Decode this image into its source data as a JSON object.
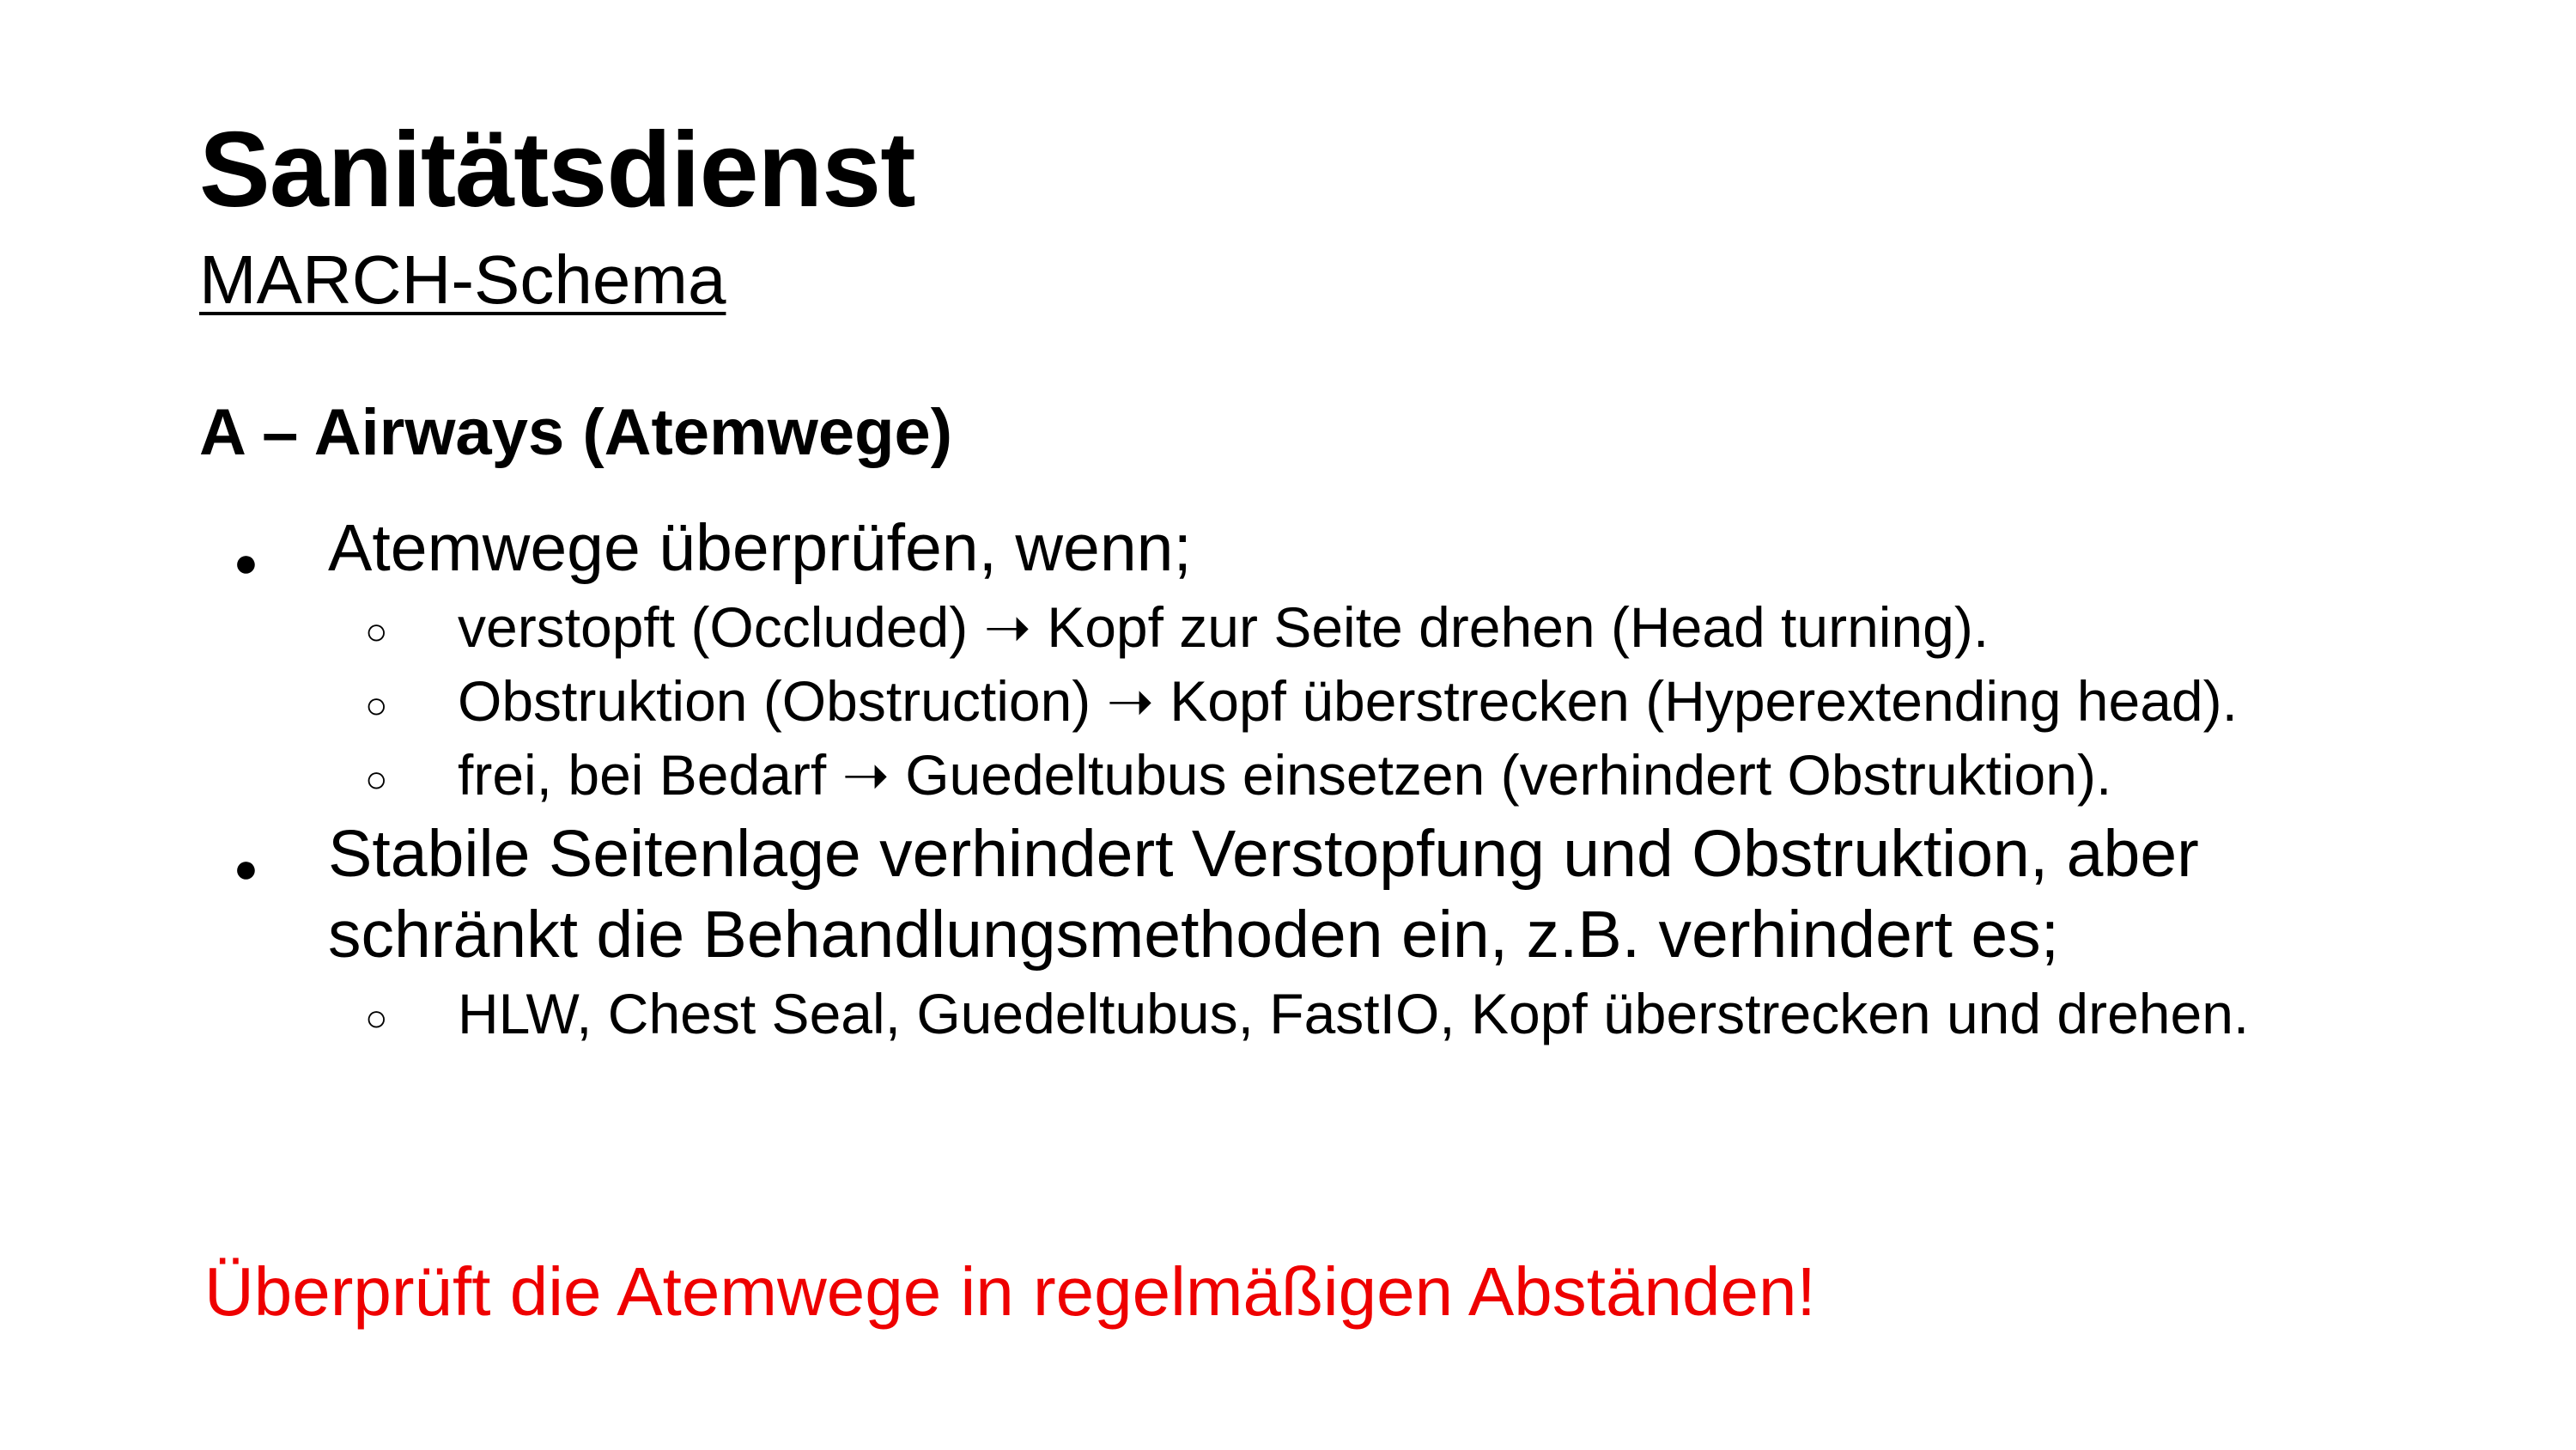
{
  "slide": {
    "title": "Sanitätsdienst",
    "subtitle": "MARCH-Schema",
    "section_heading": "A – Airways (Atemwege)",
    "bullets": [
      {
        "marker": "●",
        "lines": [
          "Atemwege überprüfen, wenn;"
        ],
        "sub": [
          {
            "marker": "○",
            "text": "verstopft (Occluded) ➝ Kopf zur Seite drehen (Head turning)."
          },
          {
            "marker": "○",
            "text": "Obstruktion (Obstruction) ➝ Kopf überstrecken (Hyperextending head)."
          },
          {
            "marker": "○",
            "text": "frei, bei Bedarf ➝ Guedeltubus einsetzen (verhindert Obstruktion)."
          }
        ]
      },
      {
        "marker": "●",
        "lines": [
          "Stabile Seitenlage verhindert Verstopfung und Obstruktion, aber",
          "schränkt die Behandlungsmethoden ein, z.B. verhindert es;"
        ],
        "sub": [
          {
            "marker": "○",
            "text": "HLW, Chest Seal, Guedeltubus, FastIO, Kopf überstrecken und drehen."
          }
        ]
      }
    ],
    "warning": "Überprüft die Atemwege in regelmäßigen Abständen!",
    "colors": {
      "text": "#000000",
      "warning": "#ee0000",
      "background": "#ffffff"
    }
  }
}
